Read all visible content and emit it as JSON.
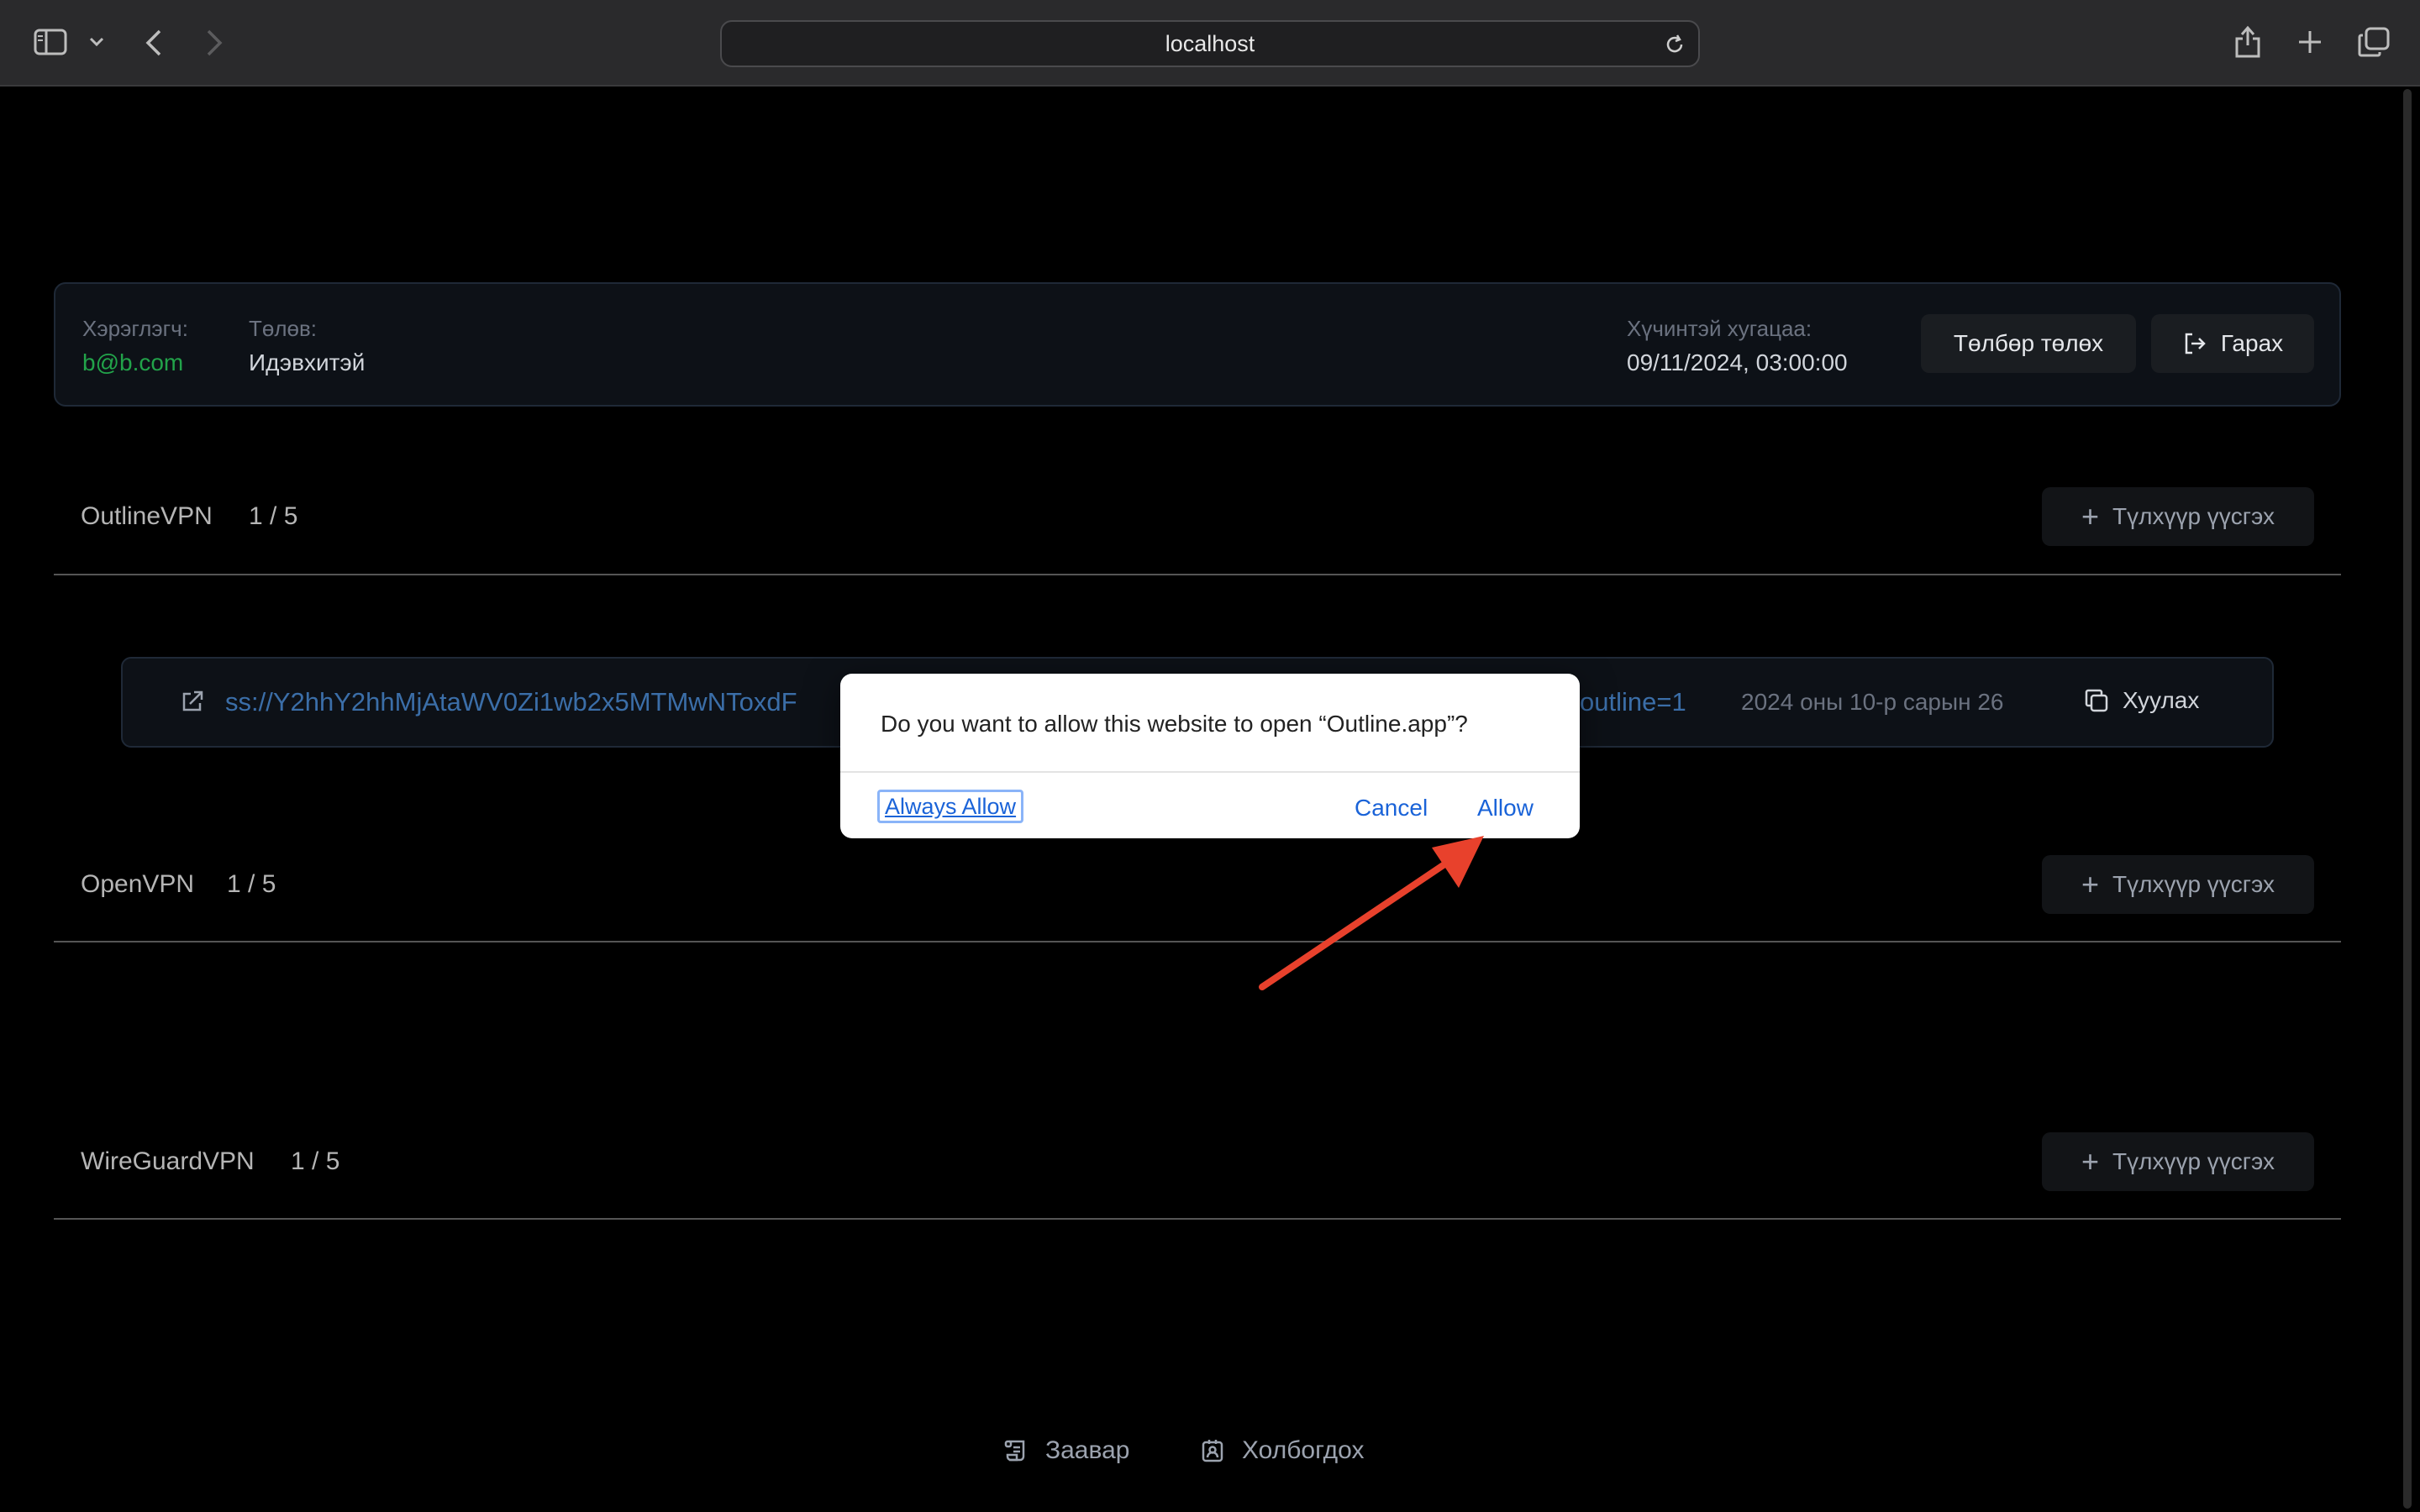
{
  "browser": {
    "url": "localhost"
  },
  "account": {
    "user_label": "Хэрэглэгч:",
    "user_value": "b@b.com",
    "status_label": "Төлөв:",
    "status_value": "Идэвхитэй",
    "expiry_label": "Хүчинтэй хугацаа:",
    "expiry_value": "09/11/2024, 03:00:00",
    "pay_button": "Төлбөр төлөх",
    "logout_button": "Гарах"
  },
  "sections": [
    {
      "name": "OutlineVPN",
      "count": "1 / 5",
      "add_label": "Түлхүүр үүсгэх"
    },
    {
      "name": "OpenVPN",
      "count": "1 / 5",
      "add_label": "Түлхүүр үүсгэх"
    },
    {
      "name": "WireGuardVPN",
      "count": "1 / 5",
      "add_label": "Түлхүүр үүсгэх"
    }
  ],
  "key": {
    "link_text": "ss://Y2hhY2hhMjAtaWV0Zi1wb2x5MTMwNToxdF",
    "link_tail": "outline=1",
    "date": "2024 оны 10-р сарын 26",
    "copy_label": "Хуулах"
  },
  "dialog": {
    "message": "Do you want to allow this website to open “Outline.app”?",
    "always_allow": "Always Allow",
    "cancel": "Cancel",
    "allow": "Allow"
  },
  "footer": {
    "guide": "Заавар",
    "contact": "Холбогдох"
  },
  "colors": {
    "accent_link": "#3b6ea8",
    "user_green": "#22a34a",
    "dialog_blue": "#1a63d8",
    "annotation_arrow": "#e8412c"
  }
}
